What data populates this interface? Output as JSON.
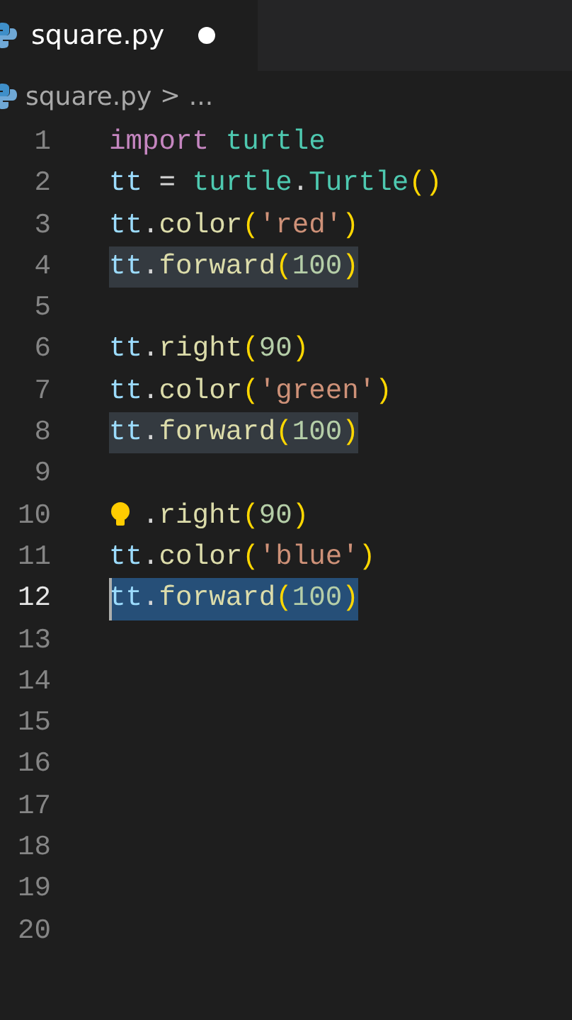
{
  "tab": {
    "label": "square.py",
    "modified": true,
    "selected": true
  },
  "breadcrumb": {
    "file": "square.py",
    "separator": ">",
    "more": "..."
  },
  "lines": [
    {
      "number": "1",
      "current": false,
      "highlighted": false,
      "selected": false,
      "tokens": [
        {
          "kind": "keyword",
          "text": "import"
        },
        {
          "kind": "class",
          "text": " turtle"
        }
      ]
    },
    {
      "number": "2",
      "current": false,
      "highlighted": false,
      "selected": false,
      "tokens": [
        {
          "kind": "variable",
          "text": "tt"
        },
        {
          "kind": "plain",
          "text": " = "
        },
        {
          "kind": "class",
          "text": "turtle"
        },
        {
          "kind": "plain",
          "text": "."
        },
        {
          "kind": "class",
          "text": "Turtle"
        },
        {
          "kind": "paren",
          "text": "()"
        }
      ]
    },
    {
      "number": "3",
      "current": false,
      "highlighted": false,
      "selected": false,
      "tokens": [
        {
          "kind": "variable",
          "text": "tt"
        },
        {
          "kind": "plain",
          "text": "."
        },
        {
          "kind": "function",
          "text": "color"
        },
        {
          "kind": "paren",
          "text": "("
        },
        {
          "kind": "string",
          "text": "'red'"
        },
        {
          "kind": "paren",
          "text": ")"
        }
      ]
    },
    {
      "number": "4",
      "current": false,
      "highlighted": true,
      "selected": false,
      "tokens": [
        {
          "kind": "variable",
          "text": "tt"
        },
        {
          "kind": "plain",
          "text": "."
        },
        {
          "kind": "function",
          "text": "forward"
        },
        {
          "kind": "paren",
          "text": "("
        },
        {
          "kind": "number",
          "text": "100"
        },
        {
          "kind": "paren",
          "text": ")"
        }
      ]
    },
    {
      "number": "5",
      "current": false
    },
    {
      "number": "6",
      "current": false,
      "highlighted": false,
      "selected": false,
      "tokens": [
        {
          "kind": "variable",
          "text": "tt"
        },
        {
          "kind": "plain",
          "text": "."
        },
        {
          "kind": "function",
          "text": "right"
        },
        {
          "kind": "paren",
          "text": "("
        },
        {
          "kind": "number",
          "text": "90"
        },
        {
          "kind": "paren",
          "text": ")"
        }
      ]
    },
    {
      "number": "7",
      "current": false,
      "highlighted": false,
      "selected": false,
      "tokens": [
        {
          "kind": "variable",
          "text": "tt"
        },
        {
          "kind": "plain",
          "text": "."
        },
        {
          "kind": "function",
          "text": "color"
        },
        {
          "kind": "paren",
          "text": "("
        },
        {
          "kind": "string",
          "text": "'green'"
        },
        {
          "kind": "paren",
          "text": ")"
        }
      ]
    },
    {
      "number": "8",
      "current": false,
      "highlighted": true,
      "selected": false,
      "tokens": [
        {
          "kind": "variable",
          "text": "tt"
        },
        {
          "kind": "plain",
          "text": "."
        },
        {
          "kind": "function",
          "text": "forward"
        },
        {
          "kind": "paren",
          "text": "("
        },
        {
          "kind": "number",
          "text": "100"
        },
        {
          "kind": "paren",
          "text": ")"
        }
      ]
    },
    {
      "number": "9",
      "current": false
    },
    {
      "number": "10",
      "current": false,
      "highlighted": false,
      "selected": false,
      "lightbulb": true,
      "tokens": [
        {
          "kind": "plain",
          "text": "."
        },
        {
          "kind": "function",
          "text": "right"
        },
        {
          "kind": "paren",
          "text": "("
        },
        {
          "kind": "number",
          "text": "90"
        },
        {
          "kind": "paren",
          "text": ")"
        }
      ]
    },
    {
      "number": "11",
      "current": false,
      "highlighted": false,
      "selected": false,
      "tokens": [
        {
          "kind": "variable",
          "text": "tt"
        },
        {
          "kind": "plain",
          "text": "."
        },
        {
          "kind": "function",
          "text": "color"
        },
        {
          "kind": "paren",
          "text": "("
        },
        {
          "kind": "string",
          "text": "'blue'"
        },
        {
          "kind": "paren",
          "text": ")"
        }
      ]
    },
    {
      "number": "12",
      "current": true,
      "selected": true,
      "tokens": [
        {
          "kind": "variable",
          "text": "tt"
        },
        {
          "kind": "plain",
          "text": "."
        },
        {
          "kind": "function",
          "text": "forward"
        },
        {
          "kind": "paren",
          "text": "("
        },
        {
          "kind": "number",
          "text": "100"
        },
        {
          "kind": "paren",
          "text": ")"
        }
      ]
    },
    {
      "number": "13",
      "current": false
    },
    {
      "number": "14",
      "current": false
    },
    {
      "number": "15",
      "current": false
    },
    {
      "number": "16",
      "current": false
    },
    {
      "number": "17",
      "current": false
    },
    {
      "number": "18",
      "current": false
    },
    {
      "number": "19",
      "current": false
    },
    {
      "number": "20",
      "current": false
    }
  ]
}
